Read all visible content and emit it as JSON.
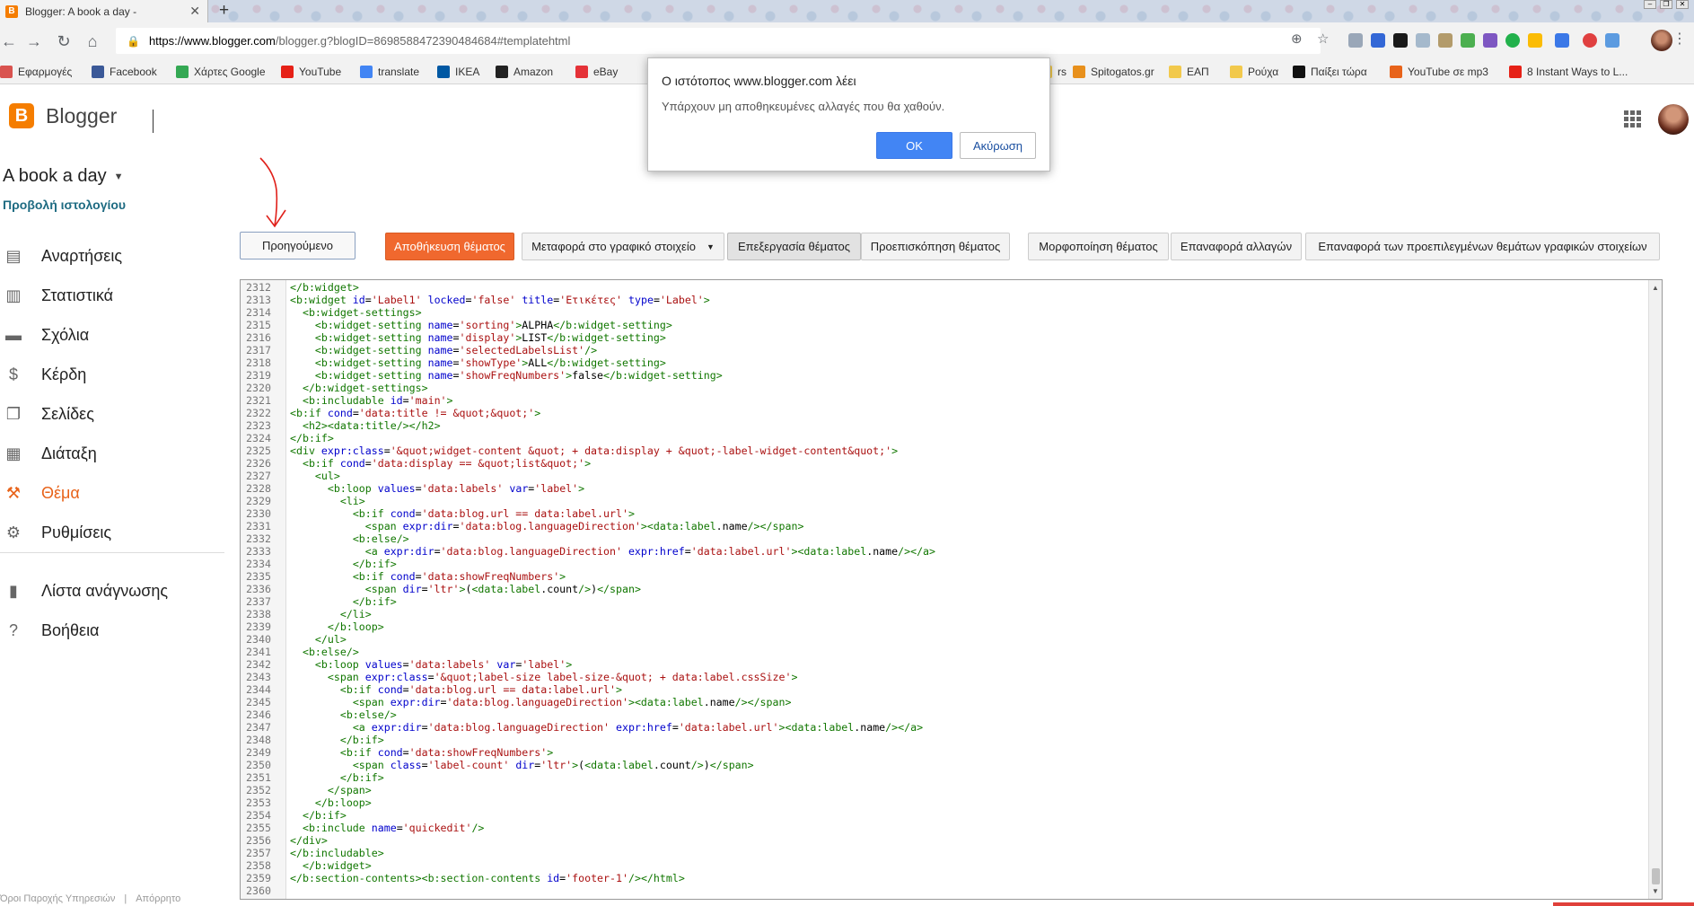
{
  "browser": {
    "tab_title": "Blogger: A book a day -",
    "tab_favicon": "B",
    "url_host": "https://www.blogger.com",
    "url_path": "/blogger.g?blogID=8698588472390484684#templatehtml",
    "bookmarks": [
      {
        "label": "Εφαρμογές",
        "icon": "apps-grid",
        "color": "#d9534f"
      },
      {
        "label": "Facebook",
        "icon": "facebook",
        "color": "#3b5998"
      },
      {
        "label": "Χάρτες Google",
        "icon": "maps",
        "color": "#34a853"
      },
      {
        "label": "YouTube",
        "icon": "youtube",
        "color": "#e62117"
      },
      {
        "label": "translate",
        "icon": "translate",
        "color": "#4285f4"
      },
      {
        "label": "IKEA",
        "icon": "ikea",
        "color": "#0058a3"
      },
      {
        "label": "Amazon",
        "icon": "amazon",
        "color": "#222222"
      },
      {
        "label": "eBay",
        "icon": "ebay",
        "color": "#e53238"
      },
      {
        "label": "rs",
        "icon": "folder",
        "color": "#f2c94c"
      },
      {
        "label": "Spitogatos.gr",
        "icon": "spitogatos",
        "color": "#e8901c"
      },
      {
        "label": "ΕΑΠ",
        "icon": "folder",
        "color": "#f2c94c"
      },
      {
        "label": "Ρούχα",
        "icon": "folder",
        "color": "#f2c94c"
      },
      {
        "label": "Παίξει τώρα",
        "icon": "paixei",
        "color": "#111111"
      },
      {
        "label": "YouTube σε mp3",
        "icon": "mp3",
        "color": "#e8631a"
      },
      {
        "label": "8 Instant Ways to L...",
        "icon": "youtube",
        "color": "#e62117"
      }
    ]
  },
  "header": {
    "brand": "Blogger",
    "logo_letter": "B"
  },
  "sidebar": {
    "blog_title": "A book a day",
    "view_blog": "Προβολή ιστολογίου",
    "items": [
      {
        "label": "Αναρτήσεις",
        "icon": "posts-icon",
        "glyph": "▤"
      },
      {
        "label": "Στατιστικά",
        "icon": "stats-icon",
        "glyph": "▥"
      },
      {
        "label": "Σχόλια",
        "icon": "comments-icon",
        "glyph": "▬"
      },
      {
        "label": "Κέρδη",
        "icon": "earnings-icon",
        "glyph": "$"
      },
      {
        "label": "Σελίδες",
        "icon": "pages-icon",
        "glyph": "❐"
      },
      {
        "label": "Διάταξη",
        "icon": "layout-icon",
        "glyph": "▦"
      },
      {
        "label": "Θέμα",
        "icon": "theme-icon",
        "glyph": "⚒"
      },
      {
        "label": "Ρυθμίσεις",
        "icon": "settings-icon",
        "glyph": "⚙"
      }
    ],
    "secondary": [
      {
        "label": "Λίστα ανάγνωσης",
        "icon": "reading-list-icon",
        "glyph": "▮"
      },
      {
        "label": "Βοήθεια",
        "icon": "help-icon",
        "glyph": "?"
      }
    ],
    "footer": [
      "Όροι Παροχής Υπηρεσιών",
      "Απόρρητο"
    ]
  },
  "actions": {
    "previous": "Προηγούμενο",
    "save_theme": "Αποθήκευση θέματος",
    "move_to_widget": "Μεταφορά στο γραφικό στοιχείο",
    "edit_theme": "Επεξεργασία θέματος",
    "preview_theme": "Προεπισκόπηση θέματος",
    "format_theme": "Μορφοποίηση θέματος",
    "revert_changes": "Επαναφορά αλλαγών",
    "restore_default_widgets": "Επαναφορά των προεπιλεγμένων θεμάτων γραφικών στοιχείων"
  },
  "dialog": {
    "title": "Ο ιστότοπος www.blogger.com λέει",
    "message": "Υπάρχουν μη αποθηκευμένες αλλαγές που θα χαθούν.",
    "ok": "OK",
    "cancel": "Ακύρωση"
  },
  "editor": {
    "lines": [
      {
        "n": "2312",
        "t": "</b:widget>"
      },
      {
        "n": "2313",
        "t": "<b:widget id='Label1' locked='false' title='Ετικέτες' type='Label'>"
      },
      {
        "n": "2314",
        "t": "  <b:widget-settings>"
      },
      {
        "n": "2315",
        "t": "    <b:widget-setting name='sorting'>ALPHA</b:widget-setting>"
      },
      {
        "n": "2316",
        "t": "    <b:widget-setting name='display'>LIST</b:widget-setting>"
      },
      {
        "n": "2317",
        "t": "    <b:widget-setting name='selectedLabelsList'/>"
      },
      {
        "n": "2318",
        "t": "    <b:widget-setting name='showType'>ALL</b:widget-setting>"
      },
      {
        "n": "2319",
        "t": "    <b:widget-setting name='showFreqNumbers'>false</b:widget-setting>"
      },
      {
        "n": "2320",
        "t": "  </b:widget-settings>"
      },
      {
        "n": "2321",
        "t": "  <b:includable id='main'>"
      },
      {
        "n": "2322",
        "t": "<b:if cond='data:title != &quot;&quot;'>"
      },
      {
        "n": "2323",
        "t": "  <h2><data:title/></h2>"
      },
      {
        "n": "2324",
        "t": "</b:if>"
      },
      {
        "n": "2325",
        "t": "<div expr:class='&quot;widget-content &quot; + data:display + &quot;-label-widget-content&quot;'>"
      },
      {
        "n": "2326",
        "t": "  <b:if cond='data:display == &quot;list&quot;'>"
      },
      {
        "n": "2327",
        "t": "    <ul>"
      },
      {
        "n": "2328",
        "t": "      <b:loop values='data:labels' var='label'>"
      },
      {
        "n": "2329",
        "t": "        <li>"
      },
      {
        "n": "2330",
        "t": "          <b:if cond='data:blog.url == data:label.url'>"
      },
      {
        "n": "2331",
        "t": "            <span expr:dir='data:blog.languageDirection'><data:label.name/></span>"
      },
      {
        "n": "2332",
        "t": "          <b:else/>"
      },
      {
        "n": "2333",
        "t": "            <a expr:dir='data:blog.languageDirection' expr:href='data:label.url'><data:label.name/></a>"
      },
      {
        "n": "2334",
        "t": "          </b:if>"
      },
      {
        "n": "2335",
        "t": "          <b:if cond='data:showFreqNumbers'>"
      },
      {
        "n": "2336",
        "t": "            <span dir='ltr'>(<data:label.count/>)</span>"
      },
      {
        "n": "2337",
        "t": "          </b:if>"
      },
      {
        "n": "2338",
        "t": "        </li>"
      },
      {
        "n": "2339",
        "t": "      </b:loop>"
      },
      {
        "n": "2340",
        "t": "    </ul>"
      },
      {
        "n": "2341",
        "t": "  <b:else/>"
      },
      {
        "n": "2342",
        "t": "    <b:loop values='data:labels' var='label'>"
      },
      {
        "n": "2343",
        "t": "      <span expr:class='&quot;label-size label-size-&quot; + data:label.cssSize'>"
      },
      {
        "n": "2344",
        "t": "        <b:if cond='data:blog.url == data:label.url'>"
      },
      {
        "n": "2345",
        "t": "          <span expr:dir='data:blog.languageDirection'><data:label.name/></span>"
      },
      {
        "n": "2346",
        "t": "        <b:else/>"
      },
      {
        "n": "2347",
        "t": "          <a expr:dir='data:blog.languageDirection' expr:href='data:label.url'><data:label.name/></a>"
      },
      {
        "n": "2348",
        "t": "        </b:if>"
      },
      {
        "n": "2349",
        "t": "        <b:if cond='data:showFreqNumbers'>"
      },
      {
        "n": "2350",
        "t": "          <span class='label-count' dir='ltr'>(<data:label.count/>)</span>"
      },
      {
        "n": "2351",
        "t": "        </b:if>"
      },
      {
        "n": "2352",
        "t": "      </span>"
      },
      {
        "n": "2353",
        "t": "    </b:loop>"
      },
      {
        "n": "2354",
        "t": "  </b:if>"
      },
      {
        "n": "2355",
        "t": "  <b:include name='quickedit'/>"
      },
      {
        "n": "2356",
        "t": "</div>"
      },
      {
        "n": "2357",
        "t": "</b:includable>"
      },
      {
        "n": "2358",
        "t": "  </b:widget>"
      },
      {
        "n": "2359",
        "t": "</b:section-contents><b:section-contents id='footer-1'/></html>"
      },
      {
        "n": "2360",
        "t": ""
      }
    ]
  },
  "colors": {
    "accent": "#f0682e",
    "link": "#1e6b82",
    "dialog_ok": "#4285f4",
    "code_tag": "#117700",
    "code_attr": "#0000cc",
    "code_value": "#aa1111"
  }
}
